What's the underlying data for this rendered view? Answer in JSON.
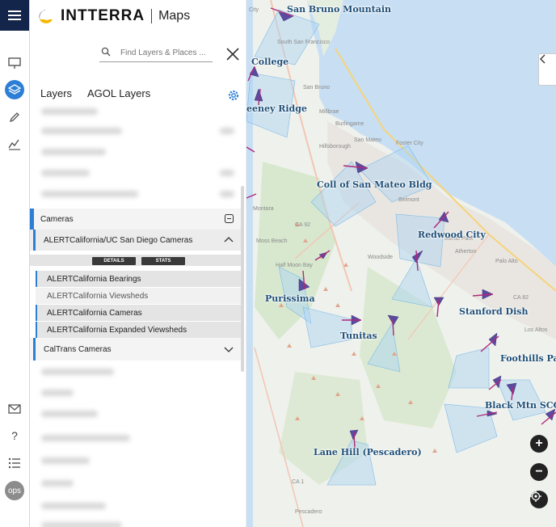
{
  "brand": {
    "name": "INTTERRA",
    "product": "Maps"
  },
  "search": {
    "placeholder": "Find Layers & Places ..."
  },
  "tabs": [
    {
      "label": "Layers"
    },
    {
      "label": "AGOL Layers"
    }
  ],
  "layers": {
    "cameras_group": "Cameras",
    "alert_group": "ALERTCalifornia/UC San Diego Cameras",
    "details_label": "DETAILS",
    "stats_label": "STATS",
    "items": [
      {
        "label": "ALERTCalifornia Bearings"
      },
      {
        "label": "ALERTCalifornia Viewsheds"
      },
      {
        "label": "ALERTCalifornia Cameras"
      },
      {
        "label": "ALERTCalifornia Expanded Viewsheds"
      }
    ],
    "caltrans_group": "CalTrans Cameras"
  },
  "rail": {
    "avatar": "ops",
    "help": "?"
  },
  "map": {
    "labels": [
      "San Bruno Mountain",
      "College",
      "eeney Ridge",
      "Coll of San Mateo Bldg",
      "Redwood City",
      "Purissima",
      "Stanford Dish",
      "Tunitas",
      "Foothills Park",
      "Black Mtn SCC",
      "Lane Hill (Pescadero)"
    ],
    "places": [
      "City",
      "South San Francisco",
      "San Bruno",
      "Millbrae",
      "Burlingame",
      "Hillsborough",
      "San Mateo",
      "Foster City",
      "Belmont",
      "Atherton",
      "Palo Alto",
      "Montara",
      "Moss Beach",
      "Half Moon Bay",
      "Woodside",
      "Menlo Park",
      "Los Altos",
      "Pescadero",
      "CA 92",
      "CA 82",
      "CA 1"
    ],
    "controls": {
      "zoom_in": "+",
      "zoom_out": "−"
    }
  }
}
